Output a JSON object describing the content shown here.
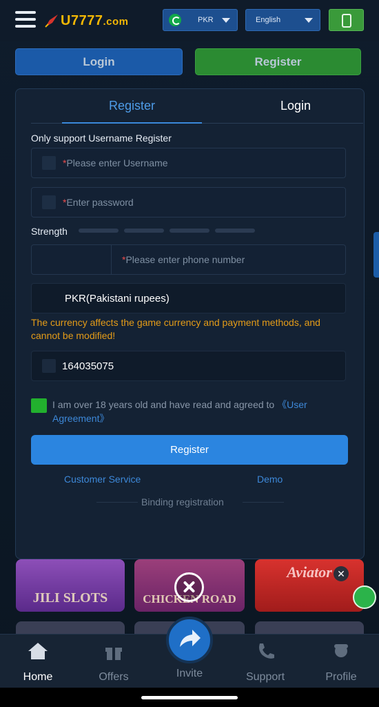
{
  "header": {
    "logo_text": "U7777",
    "logo_suffix": ".com",
    "currency_selector": "PKR",
    "language_selector": "English"
  },
  "top_buttons": {
    "login": "Login",
    "register": "Register"
  },
  "form": {
    "tabs": [
      "Register",
      "Login"
    ],
    "active_tab": "Register",
    "support_note": "Only support Username Register",
    "username_placeholder": "Please enter Username",
    "password_placeholder": "Enter password",
    "strength_label": "Strength",
    "phone_placeholder": "Please enter phone number",
    "currency_value": "PKR(Pakistani rupees)",
    "currency_warning": "The currency affects the game currency and payment methods, and cannot be modified!",
    "invite_code_value": "164035075",
    "agreement_text": "I am over 18 years old and have read and agreed to ",
    "agreement_link": "《User Agreement》",
    "agreement_checked": true,
    "register_button": "Register",
    "customer_service": "Customer Service",
    "demo": "Demo",
    "binding_registration": "Binding registration",
    "required_marker": "*"
  },
  "background_games": [
    {
      "name": "JILI SLOTS"
    },
    {
      "name": "CHICKEN ROAD"
    },
    {
      "name": "Aviator"
    }
  ],
  "bottom_nav": {
    "items": [
      {
        "label": "Home",
        "icon": "home-icon",
        "active": true
      },
      {
        "label": "Offers",
        "icon": "gift-icon",
        "active": false
      },
      {
        "label": "Invite",
        "icon": "share-icon",
        "active": false
      },
      {
        "label": "Support",
        "icon": "phone-icon",
        "active": false
      },
      {
        "label": "Profile",
        "icon": "profile-icon",
        "active": false
      }
    ]
  },
  "colors": {
    "accent_blue": "#2b85e0",
    "register_green": "#2b8b32",
    "warning_orange": "#e49c18",
    "checkbox_green": "#22b02e",
    "panel_bg": "#142234"
  }
}
